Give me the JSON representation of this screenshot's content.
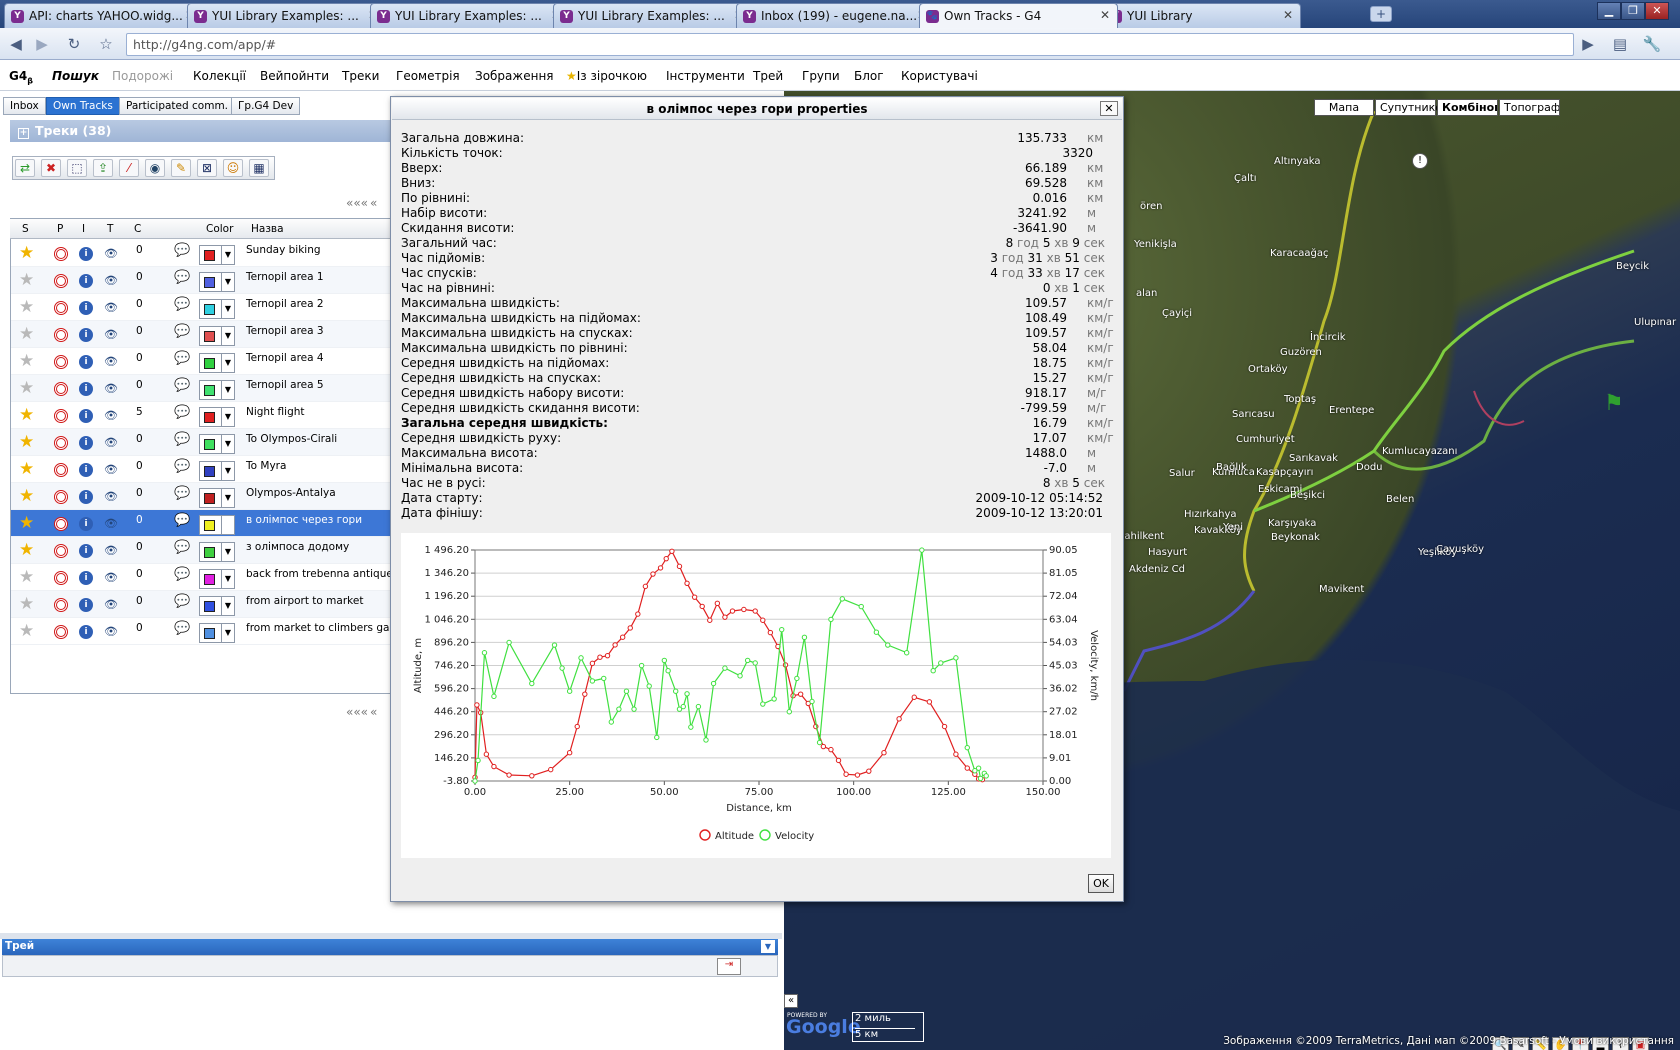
{
  "browser": {
    "tabs": [
      {
        "label": "API: charts YAHOO.widg...",
        "active": false
      },
      {
        "label": "YUI Library Examples: ...",
        "active": false
      },
      {
        "label": "YUI Library Examples: ...",
        "active": false
      },
      {
        "label": "YUI Library Examples: ...",
        "active": false
      },
      {
        "label": "Inbox (199) - eugene.na...",
        "active": false
      },
      {
        "label": "Own Tracks - G4",
        "active": true
      },
      {
        "label": "YUI Library",
        "active": false
      }
    ],
    "url": "http://g4ng.com/app/#"
  },
  "menu": {
    "logo": "G4",
    "logo_sub": "β",
    "items": [
      "Пошук",
      "Подорожі",
      "Колекції",
      "Вейпойнти",
      "Треки",
      "Геометрія",
      "Зображення",
      "Із зірочкою",
      "Інструменти",
      "Трей",
      "Групи",
      "Блог",
      "Користувачі"
    ]
  },
  "left": {
    "tabs": [
      "Inbox",
      "Own Tracks",
      "Participated comm.",
      "Гр.G4 Dev"
    ],
    "section_title": "Треки (38)",
    "pager": {
      "first": "«««",
      "prev": "«",
      "page": "1"
    },
    "columns": {
      "s": "S",
      "p": "P",
      "i": "I",
      "t": "T",
      "c": "C",
      "color": "Color",
      "name": "Назва"
    },
    "rows": [
      {
        "star": true,
        "count": "0",
        "color": "#e02020",
        "name": "Sunday biking"
      },
      {
        "star": false,
        "count": "0",
        "color": "#5060e0",
        "name": "Ternopil area 1"
      },
      {
        "star": false,
        "count": "0",
        "color": "#30d0e0",
        "name": "Ternopil area 2"
      },
      {
        "star": false,
        "count": "0",
        "color": "#e05050",
        "name": "Ternopil area 3"
      },
      {
        "star": false,
        "count": "0",
        "color": "#30d040",
        "name": "Ternopil area 4"
      },
      {
        "star": false,
        "count": "0",
        "color": "#40e070",
        "name": "Ternopil area 5"
      },
      {
        "star": true,
        "count": "5",
        "color": "#e02020",
        "name": "Night flight"
      },
      {
        "star": true,
        "count": "0",
        "color": "#40e060",
        "name": "To Olympos-Cirali"
      },
      {
        "star": true,
        "count": "0",
        "color": "#3040c0",
        "name": "To Myra"
      },
      {
        "star": true,
        "count": "0",
        "color": "#c02020",
        "name": "Olympos-Antalya"
      },
      {
        "star": true,
        "count": "0",
        "color": "#f0f020",
        "name": "в олімпос через гори",
        "selected": true
      },
      {
        "star": true,
        "count": "0",
        "color": "#40d040",
        "name": "з олімпоса додому"
      },
      {
        "star": false,
        "count": "0",
        "color": "#e020e0",
        "name": "back from trebenna antique city"
      },
      {
        "star": false,
        "count": "0",
        "color": "#3050e0",
        "name": "from airport to market"
      },
      {
        "star": false,
        "count": "0",
        "color": "#5090e0",
        "name": "from market to climbers garden"
      }
    ],
    "tray_title": "Трей"
  },
  "map": {
    "types": [
      "Мапа",
      "Супутников",
      "Комбінован",
      "Топографія"
    ],
    "active_type": "Комбінован",
    "labels": [
      "Altınyaka",
      "Çaltı",
      "ören",
      "Yenikişla",
      "Karacaağaç",
      "Beycik",
      "alan",
      "Çayiçi",
      "Ulupınar",
      "İncircik",
      "Guzören",
      "Ortaköy",
      "Toptaş",
      "Erentepe",
      "Sarıcasu",
      "Cumhuriyet",
      "Sarıkavak",
      "Kumluca",
      "Kumlucayazanı",
      "Bağlık",
      "Kasapçayırı",
      "Salur",
      "Eskicami",
      "Beşikci",
      "Belen",
      "Hızırkahya",
      "Karşıyaka",
      "Kavakköy",
      "Yeni",
      "Beykonak",
      "Sahilkent",
      "Hasyurt",
      "Yeşilköy",
      "Çavuşköy",
      "Mavikent",
      "Akdeniz Cd",
      "Dodu"
    ],
    "scale_mi": "2 миль",
    "scale_km": "5 км",
    "powered_by": "POWERED BY",
    "google": "Google",
    "copyright": "Зображення ©2009 TerraMetrics, Дані мап ©2009 Basarsoft - Умови використання"
  },
  "dialog": {
    "title": "в олімпос через гори properties",
    "props": [
      {
        "label": "Загальна довжина:",
        "value": "135.733",
        "unit": "км"
      },
      {
        "label": "Кількість точок:",
        "value": "3320",
        "unit": ""
      },
      {
        "label": "Вверх:",
        "value": "66.189",
        "unit": "км"
      },
      {
        "label": "Вниз:",
        "value": "69.528",
        "unit": "км"
      },
      {
        "label": "По рівнині:",
        "value": "0.016",
        "unit": "км"
      },
      {
        "label": "Набір висоти:",
        "value": "3241.92",
        "unit": "м"
      },
      {
        "label": "Скидання висоти:",
        "value": "-3641.90",
        "unit": "м"
      },
      {
        "label": "Загальний час:",
        "time": [
          "8",
          "год",
          "5",
          "хв",
          "9",
          "сек"
        ]
      },
      {
        "label": "Час підйомів:",
        "time": [
          "3",
          "год",
          "31",
          "хв",
          "51",
          "сек"
        ]
      },
      {
        "label": "Час спусків:",
        "time": [
          "4",
          "год",
          "33",
          "хв",
          "17",
          "сек"
        ]
      },
      {
        "label": "Час на рівнині:",
        "time": [
          "0",
          "хв",
          "1",
          "сек"
        ]
      },
      {
        "label": "Максимальна швидкість:",
        "value": "109.57",
        "unit": "км/г"
      },
      {
        "label": "Максимальна швидкість на підйомах:",
        "value": "108.49",
        "unit": "км/г"
      },
      {
        "label": "Максимальна швидкість на спусках:",
        "value": "109.57",
        "unit": "км/г"
      },
      {
        "label": "Максимальна швидкість по рівнині:",
        "value": "58.04",
        "unit": "км/г"
      },
      {
        "label": "Середня швидкість на підйомах:",
        "value": "18.75",
        "unit": "км/г"
      },
      {
        "label": "Середня швидкість на спусках:",
        "value": "15.27",
        "unit": "км/г"
      },
      {
        "label": "Середня швидкість набору висоти:",
        "value": "918.17",
        "unit": "м/г"
      },
      {
        "label": "Середня швидкість скидання висоти:",
        "value": "-799.59",
        "unit": "м/г"
      },
      {
        "label": "Загальна середня швидкість:",
        "value": "16.79",
        "unit": "км/г",
        "bold": true
      },
      {
        "label": "Середня швидкість руху:",
        "value": "17.07",
        "unit": "км/г"
      },
      {
        "label": "Максимальна висота:",
        "value": "1488.0",
        "unit": "м"
      },
      {
        "label": "Мінімальна висота:",
        "value": "-7.0",
        "unit": "м"
      },
      {
        "label": "Час не в русі:",
        "time": [
          "8",
          "хв",
          "5",
          "сек"
        ]
      },
      {
        "label": "Дата старту:",
        "value": "2009-10-12 05:14:52",
        "unit": ""
      },
      {
        "label": "Дата фінішу:",
        "value": "2009-10-12 13:20:01",
        "unit": ""
      }
    ],
    "ok": "OK"
  },
  "chart_data": {
    "type": "line",
    "xlabel": "Distance, km",
    "ylabel": "Altitude, m",
    "y2label": "Velocity, km/h",
    "xlim": [
      0,
      150
    ],
    "ylim": [
      -3.8,
      1496.2
    ],
    "y2lim": [
      0,
      90.05
    ],
    "xticks": [
      "0.00",
      "25.00",
      "50.00",
      "75.00",
      "100.00",
      "125.00",
      "150.00"
    ],
    "yticks": [
      "-3.80",
      "146.20",
      "296.20",
      "446.20",
      "596.20",
      "746.20",
      "896.20",
      "1 046.20",
      "1 196.20",
      "1 346.20",
      "1 496.20"
    ],
    "y2ticks": [
      "0.00",
      "9.01",
      "18.01",
      "27.02",
      "36.02",
      "45.03",
      "54.03",
      "63.04",
      "72.04",
      "81.05",
      "90.05"
    ],
    "grid": true,
    "legend_position": "bottom",
    "series": [
      {
        "name": "Altitude",
        "color": "#e02020",
        "axis": "left",
        "x": [
          0,
          0.5,
          1.5,
          3,
          5,
          9,
          15,
          20,
          25,
          27,
          29,
          31,
          33,
          35,
          37,
          39,
          41,
          43,
          45,
          47,
          49,
          50.5,
          52,
          54,
          56,
          58,
          60,
          62,
          64,
          66,
          68,
          71,
          74,
          76,
          78,
          80,
          82,
          84,
          86,
          88,
          90,
          92,
          94,
          96,
          98,
          101,
          104,
          108,
          112,
          116,
          120,
          124,
          127,
          130,
          132,
          133,
          134
        ],
        "y": [
          20,
          490,
          440,
          170,
          90,
          35,
          30,
          70,
          180,
          350,
          560,
          760,
          800,
          810,
          880,
          930,
          990,
          1080,
          1260,
          1340,
          1380,
          1440,
          1488,
          1390,
          1280,
          1190,
          1130,
          1040,
          1150,
          1060,
          1100,
          1110,
          1100,
          1040,
          960,
          870,
          750,
          550,
          560,
          500,
          350,
          220,
          200,
          130,
          40,
          35,
          60,
          180,
          400,
          540,
          510,
          350,
          170,
          80,
          40,
          10,
          5
        ]
      },
      {
        "name": "Velocity",
        "color": "#40e040",
        "axis": "right",
        "x": [
          0,
          0.8,
          2.5,
          5,
          9,
          15,
          21,
          23,
          25,
          28,
          31,
          34,
          36,
          38,
          40,
          42,
          44,
          46,
          48,
          50,
          51,
          53,
          54,
          55,
          56,
          57,
          59,
          61,
          63,
          66,
          70,
          72,
          74,
          76,
          79,
          81,
          83,
          85,
          87,
          89,
          91,
          94,
          97,
          102,
          106,
          109,
          114,
          118,
          121,
          123,
          127,
          130,
          132,
          133,
          133.5,
          134.5,
          135
        ],
        "y": [
          0,
          8,
          50,
          33,
          54,
          38,
          53,
          44,
          35,
          48,
          39,
          40,
          23,
          28,
          35,
          28,
          45,
          37,
          17,
          47,
          43,
          35,
          28,
          29,
          34,
          21,
          29,
          16,
          38,
          44,
          41,
          47,
          46,
          30,
          32,
          59,
          27,
          40,
          56,
          31,
          15,
          63,
          71,
          68,
          58,
          53,
          50,
          90,
          43,
          46,
          48,
          13,
          4,
          5,
          1,
          3,
          2
        ]
      }
    ],
    "legend": [
      "Altitude",
      "Velocity"
    ]
  }
}
